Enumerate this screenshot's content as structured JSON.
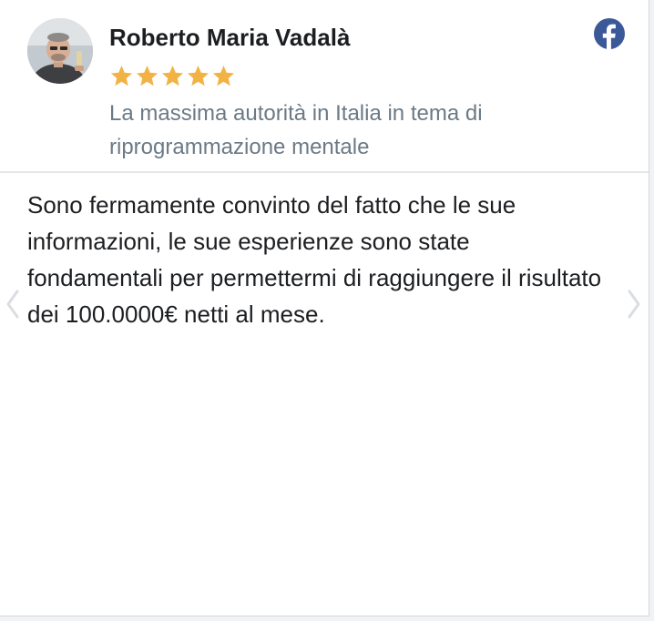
{
  "review": {
    "author_name": "Roberto Maria Vadalà",
    "rating": 5,
    "rating_max": 5,
    "tagline": "La massima autorità in Italia in tema di riprogrammazione mentale",
    "text": "Sono fermamente convinto del fatto che le sue informazioni, le sue esperienze sono state fondamentali per permettermi di raggiungere il risultato dei 100.0000€ netti al mese.",
    "source_icon": "facebook-icon",
    "star_icon": "star-icon"
  },
  "navigation": {
    "prev_icon": "chevron-left-icon",
    "next_icon": "chevron-right-icon"
  },
  "colors": {
    "star": "#f2b344",
    "facebook": "#3b5998",
    "name": "#1c1e21",
    "tagline": "#6b7a86",
    "arrow": "#dadde1"
  }
}
